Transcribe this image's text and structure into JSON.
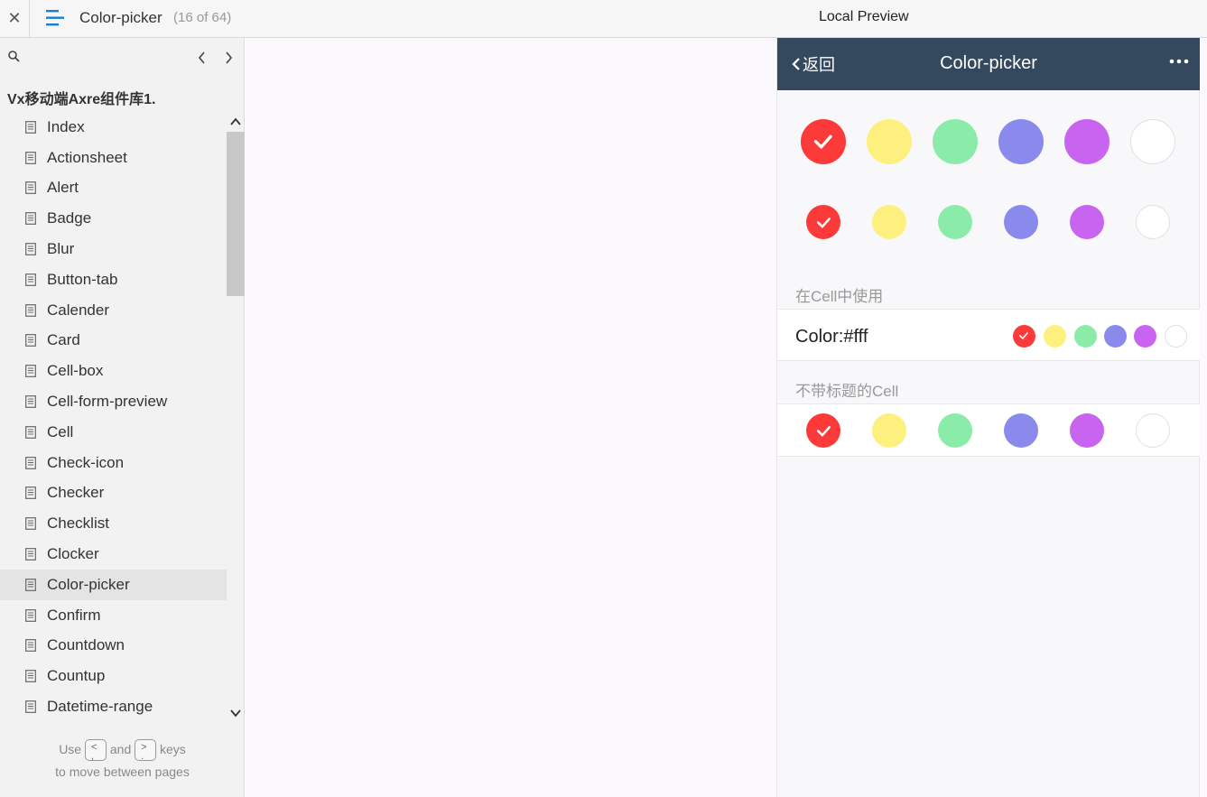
{
  "topbar": {
    "close_glyph": "✕",
    "page_name": "Color-picker",
    "page_count": "(16 of 64)",
    "preview_label": "Local Preview",
    "menu_color": "#1a7bd0"
  },
  "sidebar": {
    "project_title": "Vx移动端Axre组件库1.",
    "pages": [
      {
        "label": "Index"
      },
      {
        "label": "Actionsheet"
      },
      {
        "label": "Alert"
      },
      {
        "label": "Badge"
      },
      {
        "label": "Blur"
      },
      {
        "label": "Button-tab"
      },
      {
        "label": "Calender"
      },
      {
        "label": "Card"
      },
      {
        "label": "Cell-box"
      },
      {
        "label": "Cell-form-preview"
      },
      {
        "label": "Cell"
      },
      {
        "label": "Check-icon"
      },
      {
        "label": "Checker"
      },
      {
        "label": "Checklist"
      },
      {
        "label": "Clocker"
      },
      {
        "label": "Color-picker",
        "selected": true
      },
      {
        "label": "Confirm"
      },
      {
        "label": "Countdown"
      },
      {
        "label": "Countup"
      },
      {
        "label": "Datetime-range"
      }
    ],
    "hint": {
      "use": "Use",
      "key_prev": "<\n,",
      "and": "and",
      "key_next": ">\n.",
      "keys": "keys",
      "line2": "to move between pages"
    }
  },
  "phone": {
    "header_bg": "#35495e",
    "back_label": "返回",
    "title": "Color-picker",
    "colors": [
      "#fc3a3a",
      "#fdf07f",
      "#8aeca8",
      "#8a8aec",
      "#c864f0",
      "#ffffff"
    ],
    "selected_index": 0,
    "section_cell_label": "在Cell中使用",
    "cell_title": "Color:#fff",
    "section_no_title_label": "不带标题的Cell"
  }
}
